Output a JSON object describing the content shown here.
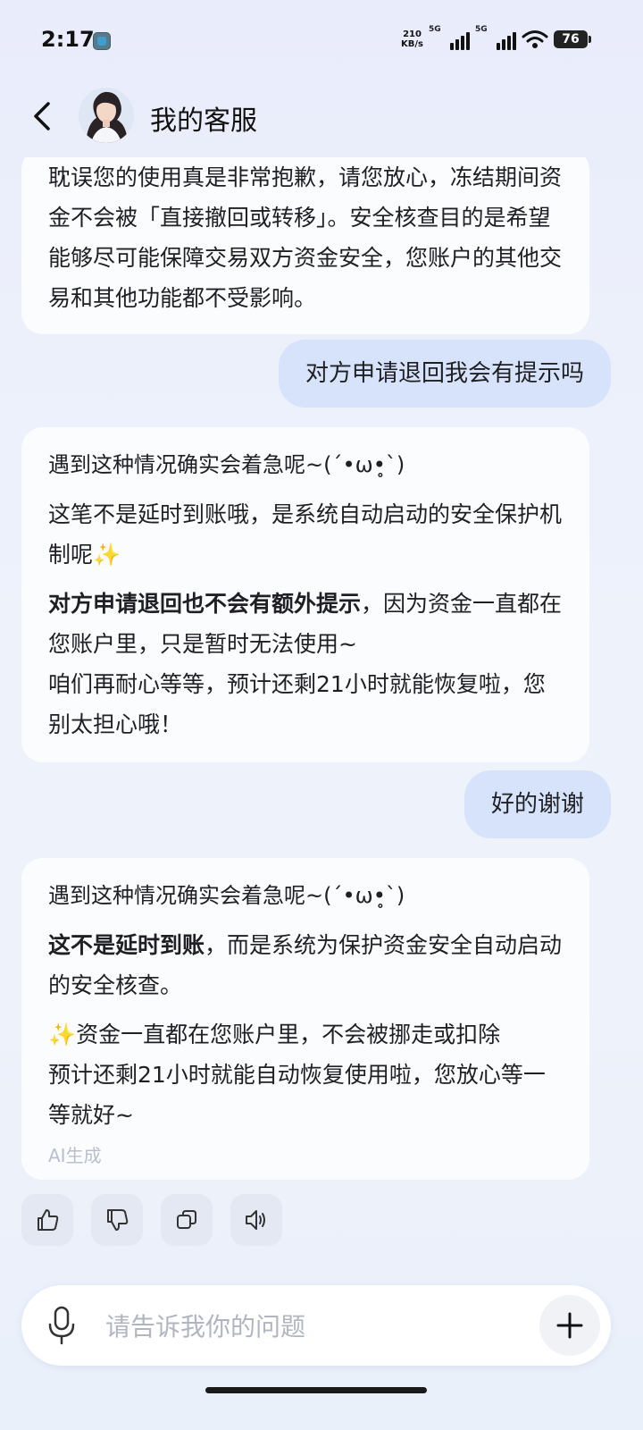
{
  "status_bar": {
    "time": "2:17",
    "net_speed_value": "210",
    "net_speed_unit": "KB/s",
    "signal1_label": "5G",
    "signal2_label": "5G",
    "battery": "76"
  },
  "header": {
    "title": "我的客服"
  },
  "messages": [
    {
      "role": "ai",
      "paragraphs": [
        "耽误您的使用真是非常抱歉，请您放心，冻结期间资金不会被「直接撤回或转移」。安全核查目的是希望能够尽可能保障交易双方资金安全，您账户的其他交易和其他功能都不受影响。"
      ]
    },
    {
      "role": "user",
      "text": "对方申请退回我会有提示吗"
    },
    {
      "role": "ai",
      "p1": "遇到这种情况确实会着急呢~(´•ω•̥`)",
      "p2": "这笔不是延时到账哦，是系统自动启动的安全保护机制呢✨",
      "p3_bold": "对方申请退回也不会有额外提示",
      "p3_rest": "，因为资金一直都在您账户里，只是暂时无法使用~",
      "p3_line2": "咱们再耐心等等，预计还剩21小时就能恢复啦，您别太担心哦！"
    },
    {
      "role": "user",
      "text": "好的谢谢"
    },
    {
      "role": "ai",
      "p1": "遇到这种情况确实会着急呢~(´•ω•̥`)",
      "p2_bold": "这不是延时到账",
      "p2_rest": "，而是系统为保护资金安全自动启动的安全核查。",
      "p3": "✨资金一直都在您账户里，不会被挪走或扣除",
      "p3_line2": "预计还剩21小时就能自动恢复使用啦，您放心等一等就好~",
      "ai_note": "AI生成"
    }
  ],
  "actions": {
    "like": "thumbs-up-icon",
    "dislike": "thumbs-down-icon",
    "copy": "copy-icon",
    "speak": "speaker-icon"
  },
  "input": {
    "placeholder": "请告诉我你的问题"
  }
}
